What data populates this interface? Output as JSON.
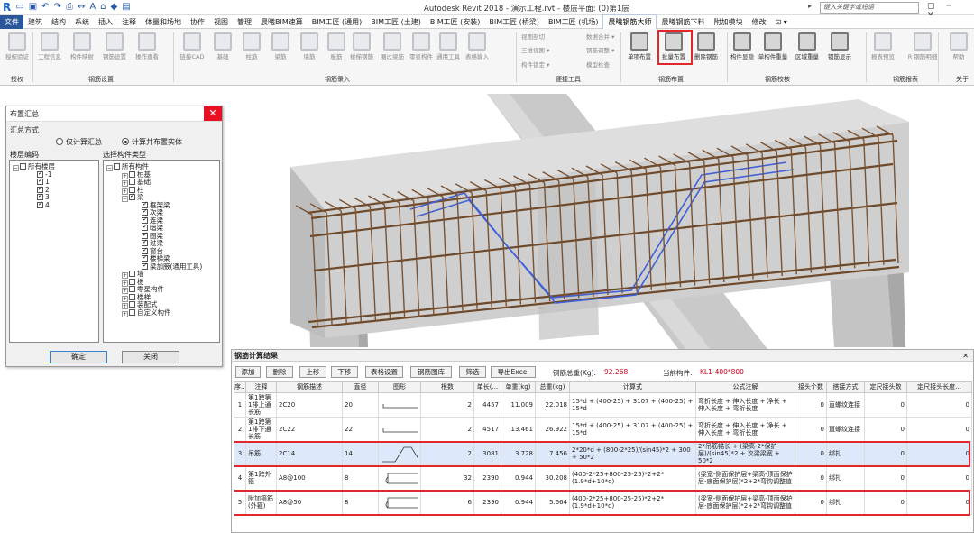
{
  "titlebar": {
    "window_title": "Autodesk Revit 2018 -   演示工程.rvt - 楼层平面: (0)第1层",
    "search_placeholder": "键入关键字或短语",
    "controls": "▢ ─ ✕"
  },
  "menu": {
    "items": [
      "文件",
      "建筑",
      "结构",
      "系统",
      "插入",
      "注释",
      "体量和场地",
      "协作",
      "视图",
      "管理",
      "晨曦BIM速算",
      "BIM工匠 (通用)",
      "BIM工匠 (土建)",
      "BIM工匠 (安装)",
      "BIM工匠 (桥梁)",
      "BIM工匠 (机场)",
      "晨曦钢筋大师",
      "晨曦钢筋下料",
      "附加模块",
      "修改",
      "⊡ ▾"
    ],
    "active": "晨曦钢筋大师"
  },
  "ribbon": {
    "buttons": [
      "授权验证",
      "工程信息",
      "构件映射",
      "钢筋设置",
      "操作查看",
      "链接CAD",
      "基础",
      "柱筋",
      "梁筋",
      "墙筋",
      "板筋",
      "楼梯钢筋",
      "圈过梁筋",
      "零星构件",
      "通用工具",
      "表格输入",
      "单项布置",
      "批量布置",
      "删除钢筋",
      "构件显隐",
      "单构件重量",
      "区域重量",
      "钢筋显示",
      "报表预览",
      "R 钢筋明细",
      "帮助"
    ],
    "small_items": [
      "视图剖切",
      "数据合并 ▾",
      "三维视图 ▾",
      "钢筋调整 ▾",
      "构件锁定 ▾",
      "模型检查"
    ],
    "groups": [
      "授权",
      "钢筋设置",
      "钢筋录入",
      "便捷工具",
      "钢筋布置",
      "钢筋校核",
      "钢筋报表",
      "关于"
    ]
  },
  "dialog": {
    "title": "布置汇总",
    "mode_label": "汇总方式",
    "mode_options": [
      "仅计算汇总",
      "计算并布置实体"
    ],
    "left_label": "楼层编码",
    "right_label": "选择构件类型",
    "floors": [
      "所有楼层",
      "-1",
      "1",
      "2",
      "3",
      "4"
    ],
    "components": [
      "所有构件",
      "桩基",
      "基础",
      "柱",
      "梁",
      "框架梁",
      "次梁",
      "连梁",
      "暗梁",
      "圈梁",
      "过梁",
      "窗台",
      "楼梯梁",
      "梁加腋(通用工具)",
      "墙",
      "板",
      "零星构件",
      "楼梯",
      "装配式",
      "自定义构件"
    ],
    "ok": "确定",
    "close": "关闭"
  },
  "result": {
    "title": "钢筋计算结果",
    "toolbar": [
      "添加",
      "删除",
      "上移",
      "下移",
      "表格设置",
      "钢筋图库",
      "筛选",
      "导出Excel"
    ],
    "total_label": "钢筋总重(Kg):",
    "total_value": "92.268",
    "current_label": "当前构件:",
    "current_value": "KL1-400*800",
    "columns": [
      "序...",
      "注释",
      "钢筋描述",
      "直径",
      "图形",
      "根数",
      "单长(...",
      "单重(kg)",
      "总重(kg)",
      "计算式",
      "公式注解",
      "接头个数",
      "搭接方式",
      "定尺接头数",
      "定尺接头长度..."
    ],
    "rows": [
      {
        "no": "1",
        "note": "第1跨第1排上通长筋",
        "desc": "2C20",
        "dia": "20",
        "count": "2",
        "len": "4457",
        "unit_w": "11.009",
        "total_w": "22.018",
        "formula": "15*d + (400-25) + 3107 + (400-25) + 15*d",
        "annot": "弯折长度 + 伸入长度 + 净长 + 伸入长度 + 弯折长度",
        "joints": "0",
        "lap": "直螺纹连接",
        "fixed_n": "0",
        "fixed_len": "0"
      },
      {
        "no": "2",
        "note": "第1跨第1排下通长筋",
        "desc": "2C22",
        "dia": "22",
        "count": "2",
        "len": "4517",
        "unit_w": "13.461",
        "total_w": "26.922",
        "formula": "15*d + (400-25) + 3107 + (400-25) + 15*d",
        "annot": "弯折长度 + 伸入长度 + 净长 + 伸入长度 + 弯折长度",
        "joints": "0",
        "lap": "直螺纹连接",
        "fixed_n": "0",
        "fixed_len": "0"
      },
      {
        "no": "3",
        "note": "吊筋",
        "desc": "2C14",
        "dia": "14",
        "count": "2",
        "len": "3081",
        "unit_w": "3.728",
        "total_w": "7.456",
        "formula": "2*20*d + (800-2*25)/(sin45)*2 + 300 + 50*2",
        "annot": "2*吊筋锚长 + (梁高-2*保护层)/(sin45)*2 + 次梁梁宽 + 50*2",
        "joints": "0",
        "lap": "绑扎",
        "fixed_n": "0",
        "fixed_len": "0"
      },
      {
        "no": "4",
        "note": "第1跨外箍",
        "desc": "A8@100",
        "dia": "8",
        "count": "32",
        "len": "2390",
        "unit_w": "0.944",
        "total_w": "30.208",
        "formula": "(400-2*25+800-25-25)*2+2*(1.9*d+10*d)",
        "annot": "(梁宽-侧面保护层+梁高-顶面保护层-底面保护层)*2+2*弯钩调整值",
        "joints": "0",
        "lap": "绑扎",
        "fixed_n": "0",
        "fixed_len": "0"
      },
      {
        "no": "5",
        "note": "附加箍筋(外箍)",
        "desc": "A8@50",
        "dia": "8",
        "count": "6",
        "len": "2390",
        "unit_w": "0.944",
        "total_w": "5.664",
        "formula": "(400-2*25+800-25-25)*2+2*(1.9*d+10*d)",
        "annot": "(梁宽-侧面保护层+梁高-顶面保护层-底面保护层)*2+2*弯钩调整值",
        "joints": "0",
        "lap": "绑扎",
        "fixed_n": "0",
        "fixed_len": "0"
      }
    ]
  },
  "colors": {
    "highlight": "#e2272a",
    "selected_row": "#dde9fb",
    "weight_value": "#d0021b"
  }
}
